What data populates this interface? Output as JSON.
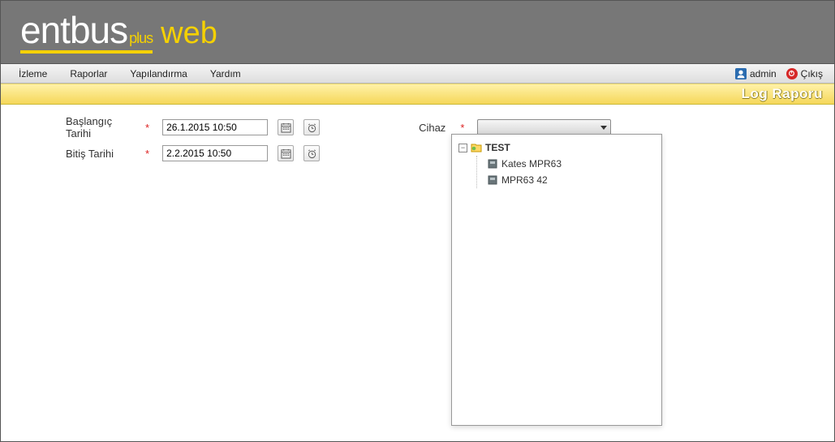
{
  "brand": {
    "main": "entbus",
    "suffix": "plus",
    "secondary": "web"
  },
  "menu": {
    "items": [
      "İzleme",
      "Raporlar",
      "Yapılandırma",
      "Yardım"
    ],
    "user": "admin",
    "logout": "Çıkış"
  },
  "page": {
    "title": "Log Raporu"
  },
  "form": {
    "start_label": "Başlangıç Tarihi",
    "start_value": "26.1.2015 10:50",
    "end_label": "Bitiş Tarihi",
    "end_value": "2.2.2015 10:50",
    "device_label": "Cihaz",
    "required_marker": "*"
  },
  "device_tree": {
    "root": "TEST",
    "children": [
      "Kates MPR63",
      "MPR63 42"
    ]
  }
}
